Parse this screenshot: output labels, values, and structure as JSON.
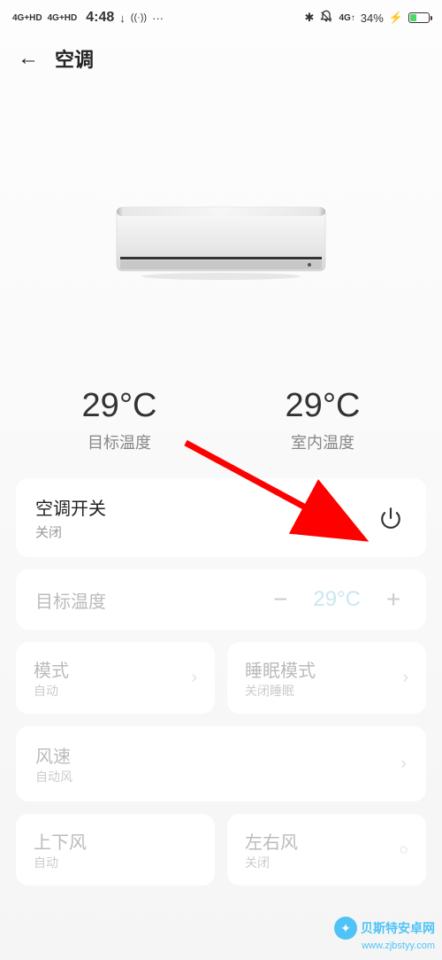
{
  "status_bar": {
    "signal_left": "4G+HD",
    "signal_right": "4G+HD",
    "time": "4:48",
    "download_icon": "↓",
    "hotspot_icon": "((·))",
    "more_icon": "···",
    "bluetooth_icon": "✱",
    "dnd_icon": "🔕",
    "network_icon": "4G↑",
    "battery_pct": "34%",
    "charging_icon": "⚡"
  },
  "header": {
    "back_icon": "←",
    "title": "空调"
  },
  "temperatures": {
    "target_value": "29°C",
    "target_label": "目标温度",
    "indoor_value": "29°C",
    "indoor_label": "室内温度"
  },
  "switch_card": {
    "title": "空调开关",
    "status": "关闭"
  },
  "target_temp_card": {
    "label": "目标温度",
    "minus": "−",
    "value": "29°C",
    "plus": "+"
  },
  "mode_card": {
    "title": "模式",
    "value": "自动"
  },
  "sleep_card": {
    "title": "睡眠模式",
    "value": "关闭睡眠"
  },
  "fan_card": {
    "title": "风速",
    "value": "自动风"
  },
  "vert_wind_card": {
    "title": "上下风",
    "value": "自动"
  },
  "horiz_wind_card": {
    "title": "左右风",
    "value": "关闭"
  },
  "watermark": {
    "text": "贝斯特安卓网",
    "url": "www.zjbstyy.com"
  }
}
